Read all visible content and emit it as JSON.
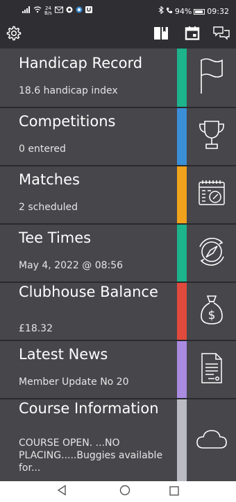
{
  "status_bar": {
    "net_speed_value": "24",
    "net_speed_unit": "B/s",
    "battery": "94%",
    "time": "09:32"
  },
  "toolbar": {
    "icons": [
      "gear-icon",
      "scorecard-icon",
      "calendar-icon",
      "chat-icon"
    ]
  },
  "tiles": [
    {
      "title": "Handicap Record",
      "subtitle": "18.6 handicap index",
      "accent": "#1db38b",
      "icon": "flag-icon"
    },
    {
      "title": "Competitions",
      "subtitle": "0 entered",
      "accent": "#3a8fd6",
      "icon": "trophy-icon"
    },
    {
      "title": "Matches",
      "subtitle": "2 scheduled",
      "accent": "#f0a21c",
      "icon": "calendar-clock-icon"
    },
    {
      "title": "Tee Times",
      "subtitle": "May 4, 2022 @ 08:56",
      "accent": "#1db38b",
      "icon": "compass-icon"
    },
    {
      "title": "Clubhouse Balance",
      "subtitle": "£18.32",
      "accent": "#e04a3c",
      "icon": "money-bag-icon"
    },
    {
      "title": "Latest News",
      "subtitle": "Member Update No 20",
      "accent": "#a98be0",
      "icon": "document-icon"
    },
    {
      "title": "Course Information",
      "subtitle": "COURSE OPEN. ...NO PLACING.....Buggies available for...",
      "accent": "#b8bcc2",
      "icon": "cloud-icon"
    }
  ],
  "nav_bar": {
    "icons": [
      "back-icon",
      "home-icon",
      "recents-icon"
    ]
  }
}
